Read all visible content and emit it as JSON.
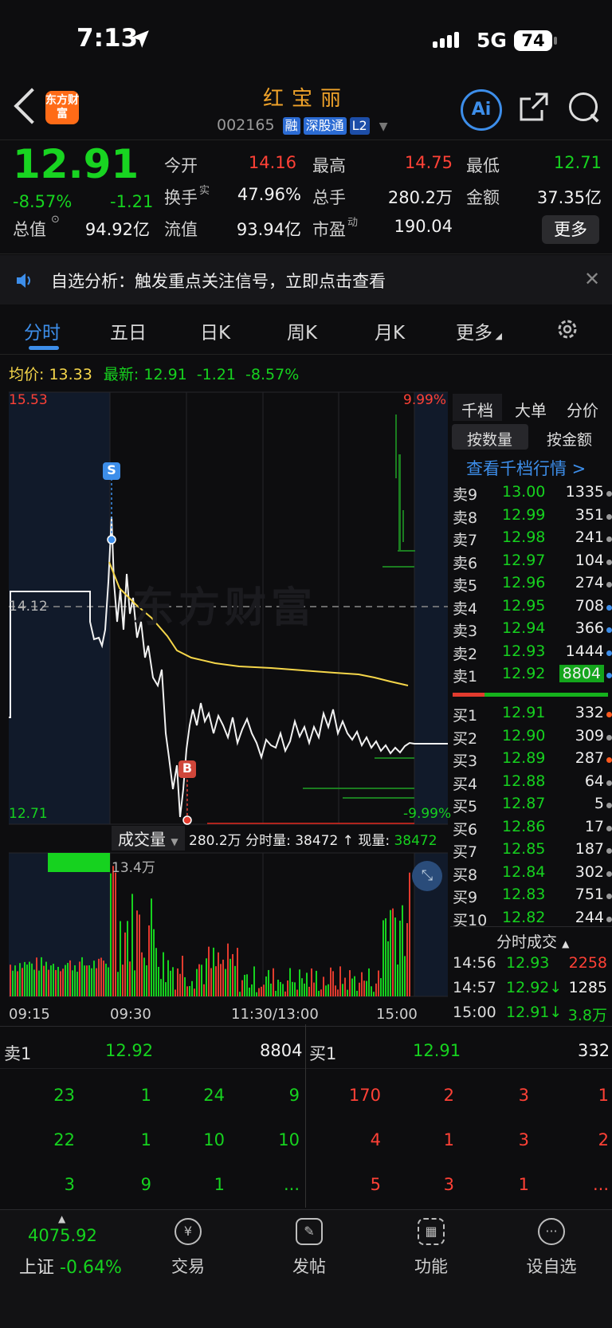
{
  "status_bar": {
    "time": "7:13",
    "network": "5G",
    "battery": "74"
  },
  "header": {
    "stock_name": "红宝丽",
    "stock_code": "002165",
    "tags": [
      "融",
      "深股通",
      "L2"
    ],
    "logo_text": "东方财富"
  },
  "quote": {
    "price": "12.91",
    "change_pct": "-8.57%",
    "change": "-1.21",
    "fields": [
      {
        "label": "今开",
        "value": "14.16",
        "color": "#ff4136"
      },
      {
        "label": "最高",
        "value": "14.75",
        "color": "#ff4136"
      },
      {
        "label": "最低",
        "value": "12.71",
        "color": "#16d21f"
      },
      {
        "label": "换手",
        "value": "47.96%",
        "color": "#f2f2f2"
      },
      {
        "label": "总手",
        "value": "280.2万",
        "color": "#f2f2f2"
      },
      {
        "label": "金额",
        "value": "37.35亿",
        "color": "#f2f2f2"
      },
      {
        "label": "总值",
        "value": "94.92亿",
        "color": "#f2f2f2"
      },
      {
        "label": "流值",
        "value": "93.94亿",
        "color": "#f2f2f2"
      },
      {
        "label": "市盈",
        "value": "190.04",
        "color": "#f2f2f2"
      }
    ],
    "turnover_sup": "实",
    "pe_sup": "动",
    "more_label": "更多"
  },
  "notice": {
    "text": "自选分析：触发重点关注信号，立即点击查看"
  },
  "tabs": [
    "分时",
    "五日",
    "日K",
    "周K",
    "月K",
    "更多"
  ],
  "avg_info": {
    "avg_label": "均价:",
    "avg_value": "13.33",
    "latest_label": "最新:",
    "latest_value": "12.91",
    "chg": "-1.21",
    "pct": "-8.57%"
  },
  "chart_labels": {
    "y_top": "15.53",
    "y_mid": "14.12",
    "y_bottom": "12.71",
    "pct_top": "9.99%",
    "pct_bottom": "-9.99%",
    "marker_s": "S",
    "marker_b": "B",
    "vol_label": "成交量",
    "vol_summary": "280.2万 分时量: 38472 ↑ 现量: ",
    "vol_now": "38472",
    "vol_max": "13.4万",
    "times": [
      "09:15",
      "09:30",
      "11:30/13:00",
      "15:00"
    ],
    "watermark": "东方财富"
  },
  "orderbook": {
    "tabs": [
      "千档",
      "大单",
      "分价"
    ],
    "sub_tabs": [
      "按数量",
      "按金额"
    ],
    "link": "查看千档行情 >",
    "asks": [
      {
        "label": "卖9",
        "price": "13.00",
        "qty": "1335",
        "dot": "#9a9a9a"
      },
      {
        "label": "卖8",
        "price": "12.99",
        "qty": "351",
        "dot": "#9a9a9a"
      },
      {
        "label": "卖7",
        "price": "12.98",
        "qty": "241",
        "dot": "#9a9a9a"
      },
      {
        "label": "卖6",
        "price": "12.97",
        "qty": "104",
        "dot": "#9a9a9a"
      },
      {
        "label": "卖5",
        "price": "12.96",
        "qty": "274",
        "dot": "#9a9a9a"
      },
      {
        "label": "卖4",
        "price": "12.95",
        "qty": "708",
        "dot": "#3d8eea"
      },
      {
        "label": "卖3",
        "price": "12.94",
        "qty": "366",
        "dot": "#3d8eea"
      },
      {
        "label": "卖2",
        "price": "12.93",
        "qty": "1444",
        "dot": "#3d8eea"
      },
      {
        "label": "卖1",
        "price": "12.92",
        "qty": "8804",
        "dot": "#3d8eea"
      }
    ],
    "bids": [
      {
        "label": "买1",
        "price": "12.91",
        "qty": "332",
        "dot": "#ff5a1f"
      },
      {
        "label": "买2",
        "price": "12.90",
        "qty": "309",
        "dot": "#9a9a9a"
      },
      {
        "label": "买3",
        "price": "12.89",
        "qty": "287",
        "dot": "#ff5a1f"
      },
      {
        "label": "买4",
        "price": "12.88",
        "qty": "64",
        "dot": "#9a9a9a"
      },
      {
        "label": "买5",
        "price": "12.87",
        "qty": "5",
        "dot": "#9a9a9a"
      },
      {
        "label": "买6",
        "price": "12.86",
        "qty": "17",
        "dot": "#9a9a9a"
      },
      {
        "label": "买7",
        "price": "12.85",
        "qty": "187",
        "dot": "#9a9a9a"
      },
      {
        "label": "买8",
        "price": "12.84",
        "qty": "302",
        "dot": "#9a9a9a"
      },
      {
        "label": "买9",
        "price": "12.83",
        "qty": "751",
        "dot": "#9a9a9a"
      },
      {
        "label": "买10",
        "price": "12.82",
        "qty": "244",
        "dot": "#9a9a9a"
      }
    ],
    "trades_header": "分时成交",
    "trades": [
      {
        "time": "14:56",
        "price": "12.93",
        "vol": "2258",
        "color": "#ff4136"
      },
      {
        "time": "14:57",
        "price": "12.92↓",
        "vol": "1285",
        "color": "#f2f2f2"
      },
      {
        "time": "15:00",
        "price": "12.91↓",
        "vol": "3.8万",
        "color": "#16d21f"
      }
    ]
  },
  "level_grid": {
    "sell_label": "卖1",
    "sell_price": "12.92",
    "sell_qty": "8804",
    "buy_label": "买1",
    "buy_price": "12.91",
    "buy_qty": "332",
    "sell_rows": [
      [
        "23",
        "1",
        "24",
        "9"
      ],
      [
        "22",
        "1",
        "10",
        "10"
      ],
      [
        "3",
        "9",
        "1",
        "..."
      ]
    ],
    "buy_rows": [
      [
        "170",
        "2",
        "3",
        "1"
      ],
      [
        "4",
        "1",
        "3",
        "2"
      ],
      [
        "5",
        "3",
        "1",
        "..."
      ]
    ]
  },
  "bottom_nav": {
    "index_value": "4075.92",
    "index_name": "上证",
    "index_pct": "-0.64%",
    "items": [
      "交易",
      "发帖",
      "功能",
      "设自选"
    ]
  },
  "colors": {
    "up": "#ff4136",
    "down": "#16d21f",
    "accent": "#3d8eea",
    "avg_line": "#f5d64a",
    "brand": "#ff6b17"
  }
}
